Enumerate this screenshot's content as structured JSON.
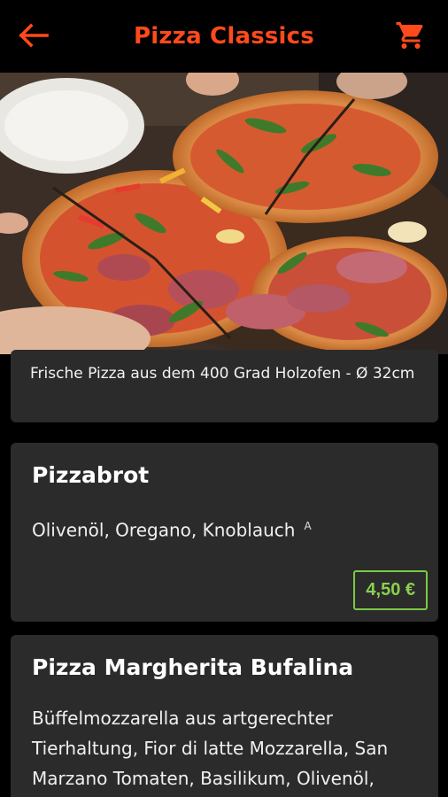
{
  "header": {
    "title": "Pizza Classics",
    "back_icon": "arrow-left-icon",
    "cart_icon": "shopping-cart-icon",
    "accent_color": "#ff4a1c"
  },
  "hero": {
    "image": "pizza-photo"
  },
  "info": {
    "text": "Frische Pizza aus dem 400 Grad Holzofen - Ø 32cm"
  },
  "products": [
    {
      "name": "Pizzabrot",
      "description": "Olivenöl, Oregano, Knoblauch",
      "allergen": "A",
      "price": "4,50 €"
    },
    {
      "name": "Pizza Margherita Bufalina",
      "description": "Büffelmozzarella aus artgerechter Tierhaltung, Fior di latte Mozzarella, San Marzano Tomaten, Basilikum, Olivenöl,"
    }
  ]
}
